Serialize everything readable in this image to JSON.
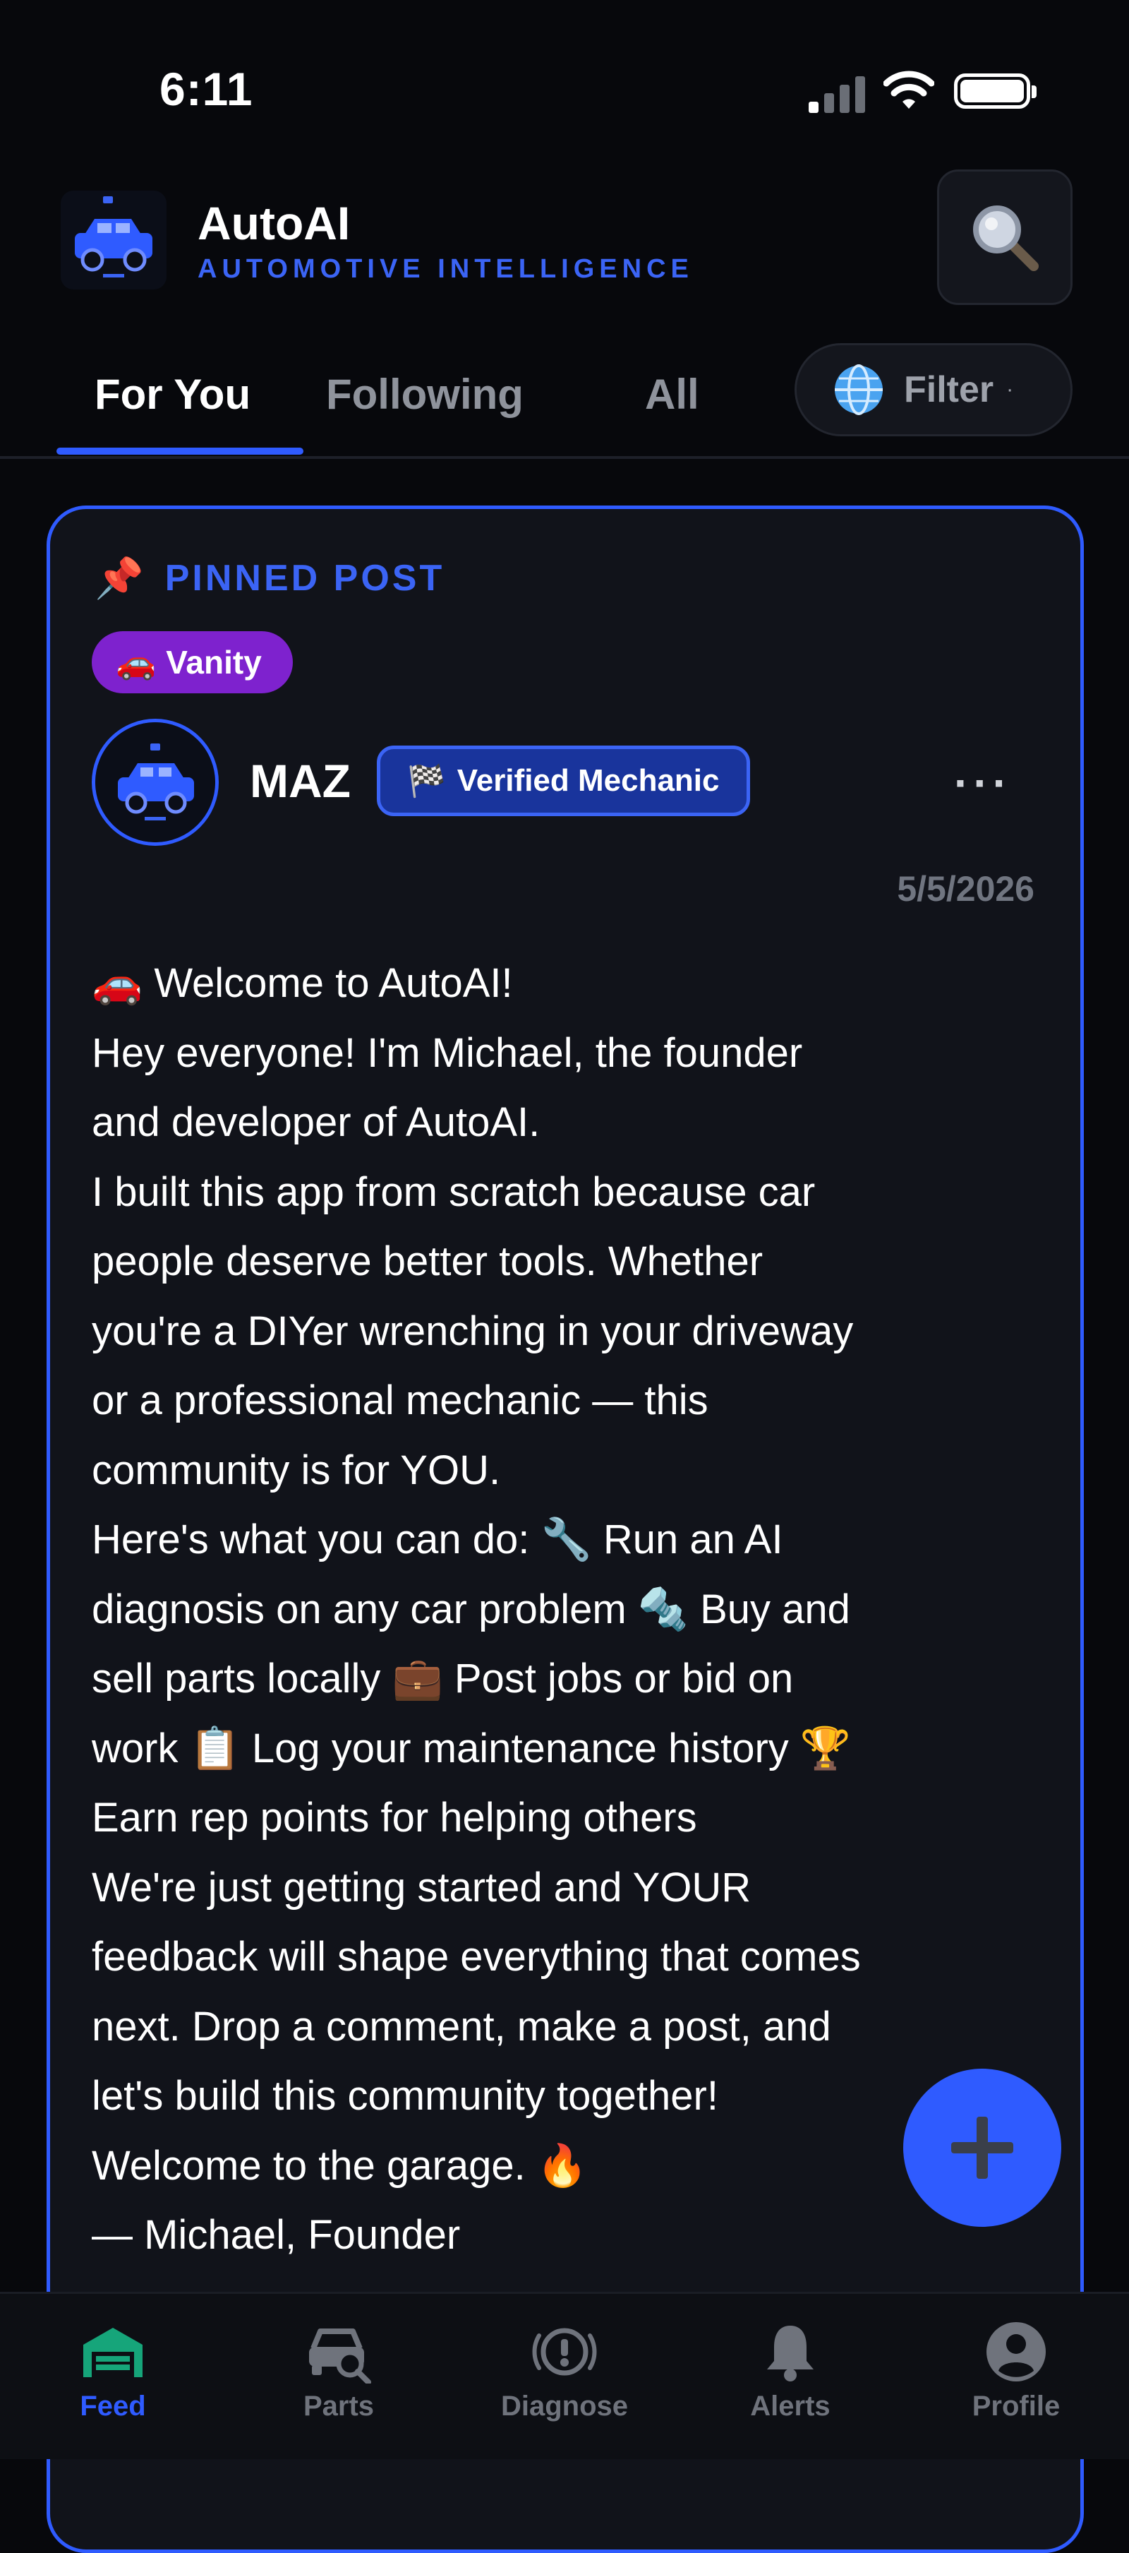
{
  "status_bar": {
    "time": "6:11"
  },
  "header": {
    "brand": "AutoAI",
    "tagline": "AUTOMOTIVE INTELLIGENCE",
    "logo_icon": "truck-logo-icon",
    "search_icon": "search-icon"
  },
  "tabs": [
    {
      "label": "For You",
      "active": true
    },
    {
      "label": "Following",
      "active": false
    },
    {
      "label": "All",
      "active": false
    }
  ],
  "filter": {
    "label": "Filter",
    "caret": "·",
    "icon": "globe-icon"
  },
  "post": {
    "pinned_label": "PINNED POST",
    "pinned_icon": "📌",
    "tag": {
      "emoji": "🚗",
      "label": "Vanity"
    },
    "author": "MAZ",
    "badge": {
      "emoji": "🏁",
      "label": "Verified Mechanic"
    },
    "more": "···",
    "date": "5/5/2026",
    "lines": [
      "🚗 Welcome to AutoAI!",
      "Hey everyone! I'm Michael, the founder",
      "and developer of AutoAI.",
      "I built this app from scratch because car",
      "people deserve better tools. Whether",
      "you're a DIYer wrenching in your driveway",
      "or a professional mechanic — this",
      "community is for YOU.",
      "Here's what you can do: 🔧 Run an AI",
      "diagnosis on any car problem 🔩 Buy and",
      "sell parts locally 💼 Post jobs or bid on",
      "work 📋 Log your maintenance history 🏆",
      "Earn rep points for helping others",
      "We're just getting started and YOUR",
      "feedback will shape everything that comes",
      "next. Drop a comment, make a post, and",
      "let's build this community together!",
      "Welcome to the garage. 🔥",
      "— Michael, Founder"
    ]
  },
  "fab": {
    "icon": "plus-icon"
  },
  "bottom_nav": [
    {
      "label": "Feed",
      "icon": "garage-icon",
      "active": true
    },
    {
      "label": "Parts",
      "icon": "car-search-icon",
      "active": false
    },
    {
      "label": "Diagnose",
      "icon": "warning-circle-icon",
      "active": false
    },
    {
      "label": "Alerts",
      "icon": "bell-icon",
      "active": false
    },
    {
      "label": "Profile",
      "icon": "user-circle-icon",
      "active": false
    }
  ],
  "colors": {
    "accent": "#2f5bff",
    "tag_purple": "#7e22ce",
    "background": "#07080c",
    "card": "#11131a",
    "active_nav": "#2f5bff",
    "garage_icon": "#16a57a"
  }
}
